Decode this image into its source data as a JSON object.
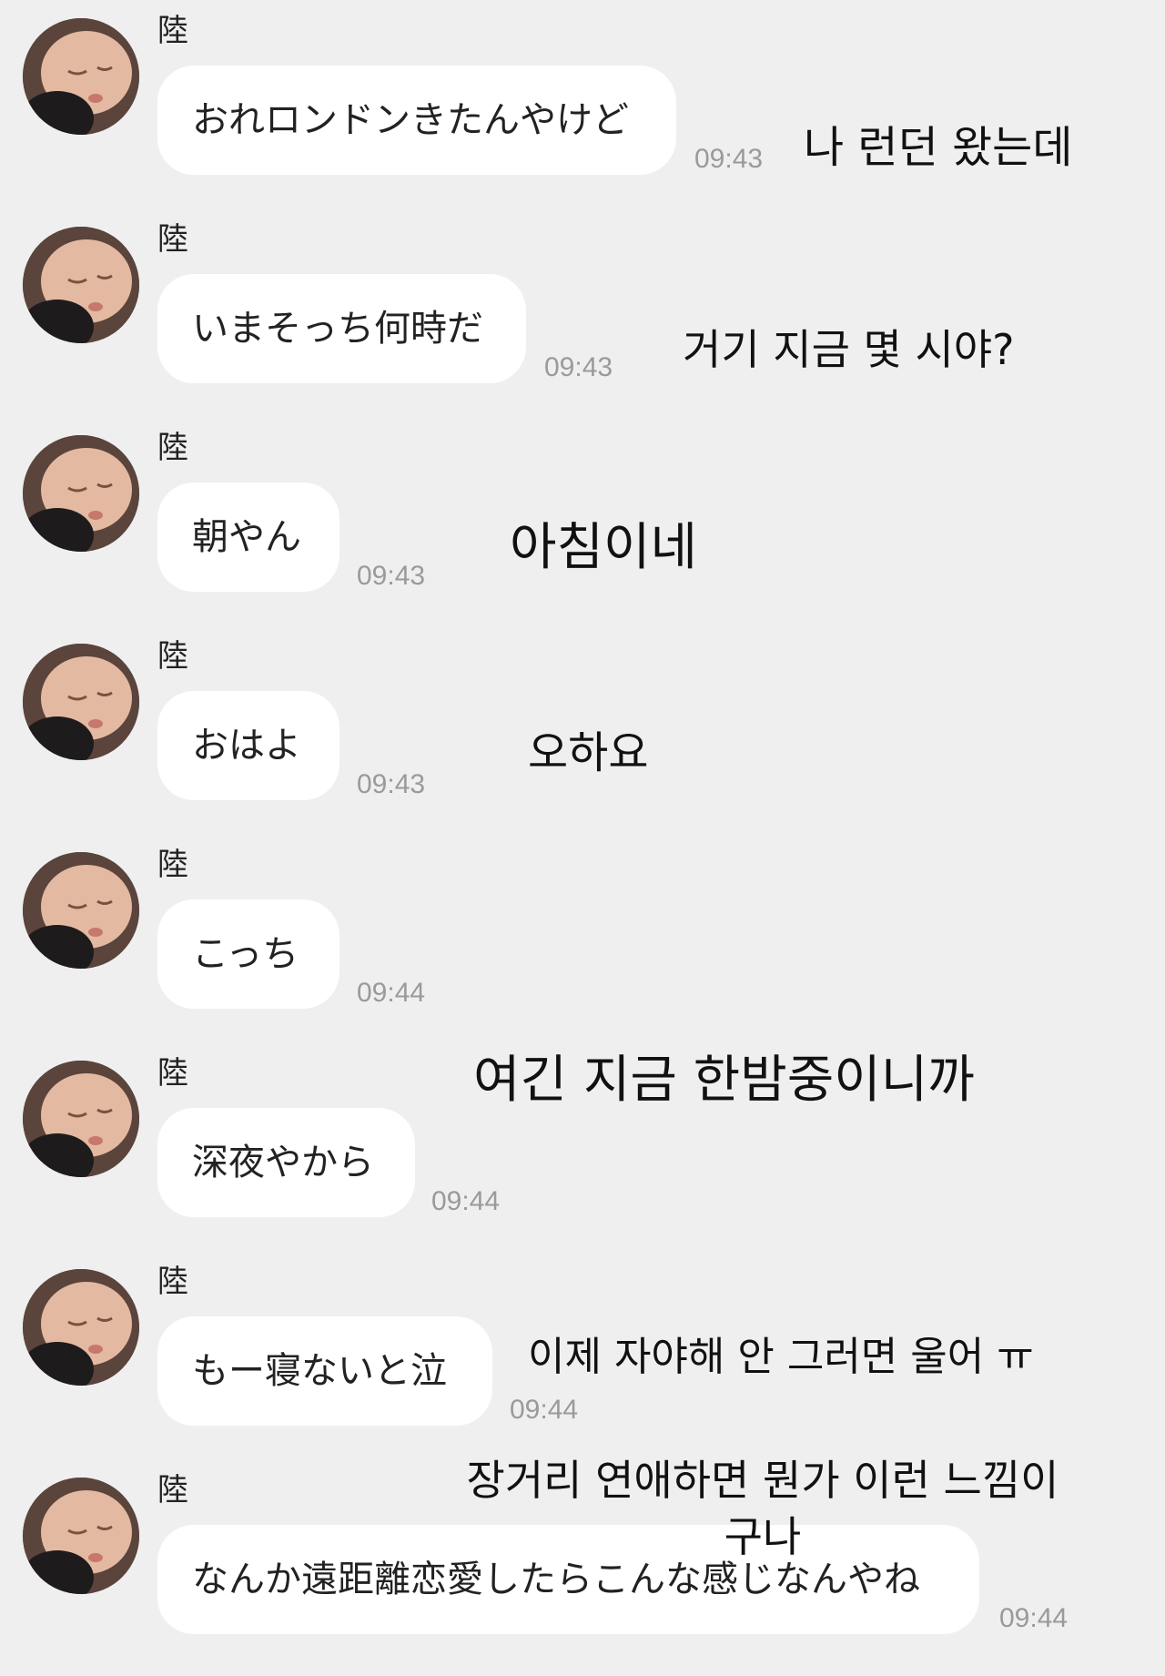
{
  "sender_name": "陸",
  "avatar": {
    "icon": "sleeping-baby-avatar-icon"
  },
  "messages": [
    {
      "text": "おれロンドンきたんやけど",
      "time": "09:43",
      "translation": "나 런던 왔는데"
    },
    {
      "text": "いまそっち何時だ",
      "time": "09:43",
      "translation": "거기 지금 몇 시야?"
    },
    {
      "text": "朝やん",
      "time": "09:43",
      "translation": "아침이네"
    },
    {
      "text": "おはよ",
      "time": "09:43",
      "translation": "오하요"
    },
    {
      "text": "こっち",
      "time": "09:44",
      "translation": ""
    },
    {
      "text": "深夜やから",
      "time": "09:44",
      "translation": "여긴 지금 한밤중이니까"
    },
    {
      "text": "もー寝ないと泣",
      "time": "09:44",
      "translation": "이제 자야해 안 그러면 울어 ㅠ"
    },
    {
      "text": "なんか遠距離恋愛したらこんな感じなんやね",
      "time": "09:44",
      "translation": "장거리 연애하면 뭔가 이런 느낌이\n구나"
    }
  ]
}
